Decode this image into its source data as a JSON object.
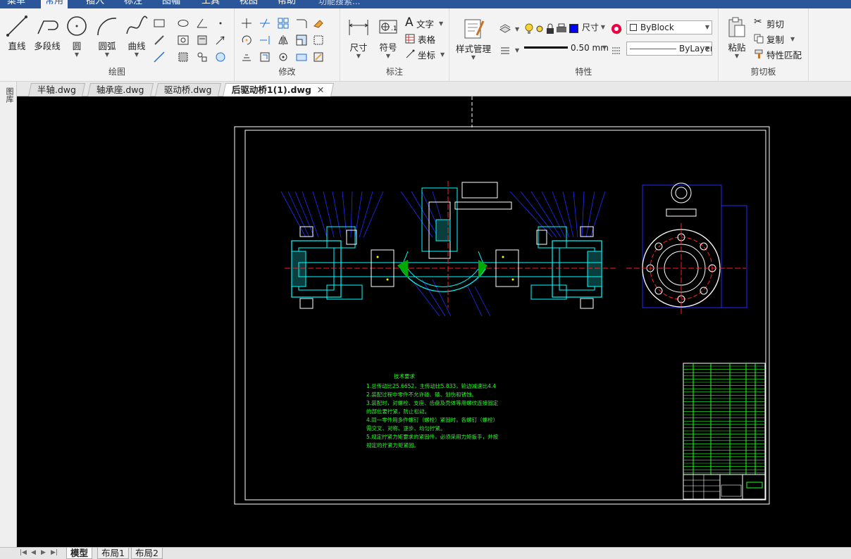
{
  "menubar": {
    "tabs": [
      "菜单",
      "常用",
      "插入",
      "标注",
      "图幅",
      "工具",
      "视图",
      "帮助"
    ],
    "active_tab": "常用",
    "search_placeholder": "功能搜索..."
  },
  "ribbon": {
    "draw": {
      "label": "绘图",
      "line": "直线",
      "polyline": "多段线",
      "circle": "圆",
      "arc": "圆弧",
      "curve": "曲线"
    },
    "modify": {
      "label": "修改"
    },
    "annotate": {
      "label": "标注",
      "dimension": "尺寸",
      "symbol": "符号",
      "text": "文字",
      "table": "表格",
      "coordinate": "坐标"
    },
    "properties": {
      "label": "特性",
      "style_manager": "样式管理",
      "layer_value": "尺寸",
      "color_value": "ByBlock",
      "lineweight_value": "0.50 mm",
      "linetype_value": "ByLayer"
    },
    "clipboard": {
      "label": "剪切板",
      "paste": "粘贴",
      "cut": "剪切",
      "copy": "复制",
      "match": "特性匹配"
    }
  },
  "doc_tabs": [
    {
      "name": "半轴.dwg",
      "active": false
    },
    {
      "name": "轴承座.dwg",
      "active": false
    },
    {
      "name": "驱动桥.dwg",
      "active": false
    },
    {
      "name": "后驱动桥1(1).dwg",
      "active": true
    }
  ],
  "left_panel": {
    "label": "图库"
  },
  "drawing": {
    "notes_title": "技术要求",
    "notes": [
      "1.总传动比25.6652，主传动比5.833，轮边减速比4.4",
      "2.装配过程中零件不允许碰、磕、划伤和锈蚀。",
      "3.装配时，对螺栓、支座、齿盘及壳体等用螺纹连接固定",
      "的部位要拧紧，防止松动。",
      "4.同一零件用多件螺钉（螺栓）紧固时，各螺钉（螺栓）",
      "需交叉、对称、逐步、均匀拧紧。",
      "5.规定拧紧力矩要求的紧固件，必须采用力矩扳手，并按",
      "规定的拧紧力矩紧固。"
    ]
  },
  "layout_tabs": [
    {
      "name": "模型",
      "active": true
    },
    {
      "name": "布局1",
      "active": false
    },
    {
      "name": "布局2",
      "active": false
    }
  ],
  "colors": {
    "canvas": "#000000",
    "frame": "#ffffff",
    "cyan": "#00ffff",
    "blue": "#1f2cff",
    "red": "#ff2020",
    "green": "#22ff22",
    "accent": "#2b579a"
  }
}
